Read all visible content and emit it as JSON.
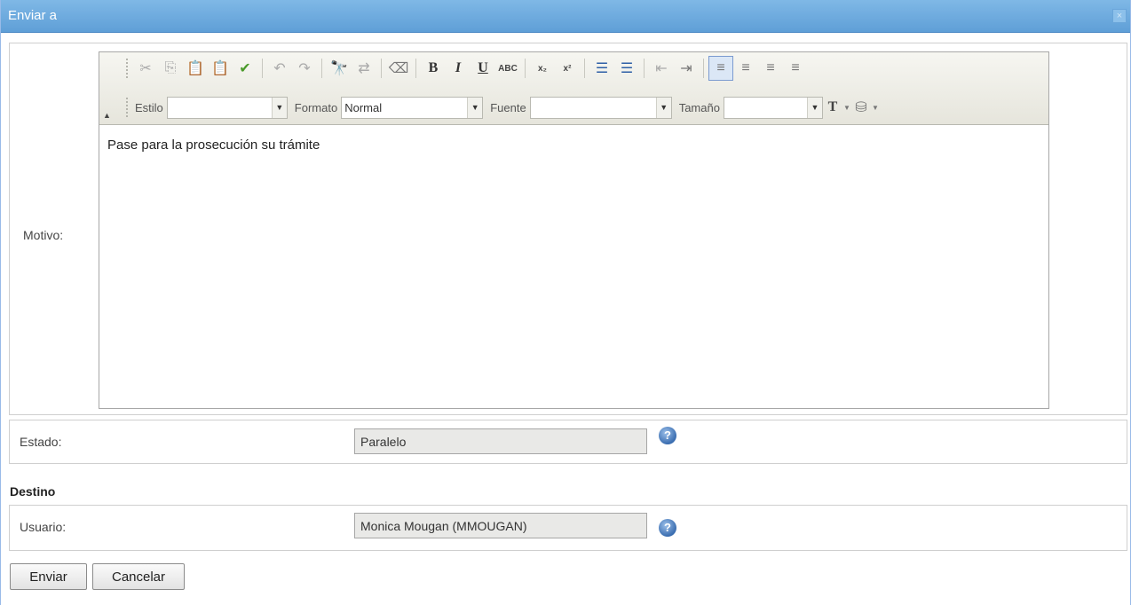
{
  "window": {
    "title": "Enviar a",
    "close_label": "×"
  },
  "motivo": {
    "label": "Motivo:",
    "toolbar": {
      "row1": [
        {
          "name": "cut-icon",
          "glyph": "✂",
          "style": "dim"
        },
        {
          "name": "copy-icon",
          "glyph": "⎘",
          "style": "dim"
        },
        {
          "name": "paste-icon",
          "glyph": "📋",
          "style": "dim"
        },
        {
          "name": "paste-word-icon",
          "glyph": "📋",
          "style": "dim"
        },
        {
          "name": "spellcheck-icon",
          "glyph": "✔",
          "style": "green"
        },
        {
          "name": "undo-icon",
          "glyph": "↶",
          "style": "dim"
        },
        {
          "name": "redo-icon",
          "glyph": "↷",
          "style": "dim"
        },
        {
          "name": "find-icon",
          "glyph": "🔭",
          "style": ""
        },
        {
          "name": "replace-icon",
          "glyph": "⇄",
          "style": "dim"
        },
        {
          "name": "eraser-icon",
          "glyph": "⌫",
          "style": ""
        },
        {
          "name": "bold-icon",
          "glyph": "B",
          "style": "bold"
        },
        {
          "name": "italic-icon",
          "glyph": "I",
          "style": "italic"
        },
        {
          "name": "underline-icon",
          "glyph": "U",
          "style": "under"
        },
        {
          "name": "strikethrough-icon",
          "glyph": "ABC",
          "style": "small"
        },
        {
          "name": "subscript-icon",
          "glyph": "x₂",
          "style": "small"
        },
        {
          "name": "superscript-icon",
          "glyph": "x²",
          "style": "small"
        },
        {
          "name": "numbered-list-icon",
          "glyph": "☰",
          "style": "blue"
        },
        {
          "name": "bulleted-list-icon",
          "glyph": "☰",
          "style": "blue"
        },
        {
          "name": "outdent-icon",
          "glyph": "⇤",
          "style": "dim"
        },
        {
          "name": "indent-icon",
          "glyph": "⇥",
          "style": ""
        },
        {
          "name": "align-left-icon",
          "glyph": "≡",
          "style": "active"
        },
        {
          "name": "align-center-icon",
          "glyph": "≡",
          "style": ""
        },
        {
          "name": "align-right-icon",
          "glyph": "≡",
          "style": ""
        },
        {
          "name": "align-justify-icon",
          "glyph": "≡",
          "style": ""
        }
      ],
      "estilo_label": "Estilo",
      "estilo_value": "",
      "formato_label": "Formato",
      "formato_value": "Normal",
      "fuente_label": "Fuente",
      "fuente_value": "",
      "tamano_label": "Tamaño",
      "tamano_value": "",
      "text_color_icon": "T",
      "bg_color_icon": "⛁",
      "dropdown_arrow": "▼"
    },
    "content": "Pase para la prosecución su trámite"
  },
  "estado": {
    "label": "Estado:",
    "value": "Paralelo",
    "help_icon": "?"
  },
  "destino": {
    "heading": "Destino",
    "usuario_label": "Usuario:",
    "usuario_value": "Monica Mougan  (MMOUGAN)",
    "help_icon": "?"
  },
  "actions": {
    "enviar": "Enviar",
    "cancelar": "Cancelar"
  }
}
